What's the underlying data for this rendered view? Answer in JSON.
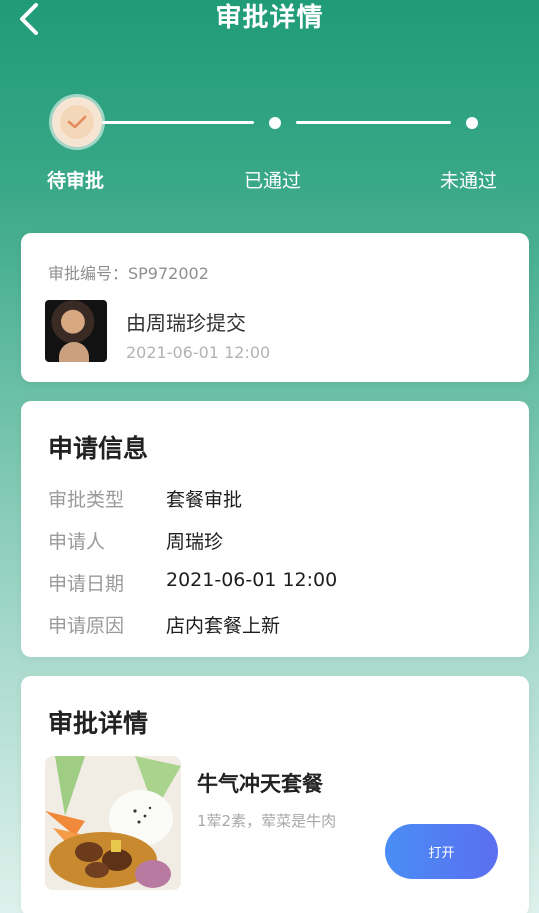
{
  "header": {
    "title": "审批详情"
  },
  "steps": [
    {
      "label": "待审批",
      "state": "active"
    },
    {
      "label": "已通过",
      "state": "pending"
    },
    {
      "label": "未通过",
      "state": "pending"
    }
  ],
  "summary": {
    "approval_no": "审批编号：SP972002",
    "submitter": "由周瑞珍提交",
    "time": "2021-06-01 12:00"
  },
  "application": {
    "title": "申请信息",
    "rows": [
      {
        "key": "审批类型",
        "value": "套餐审批"
      },
      {
        "key": "申请人",
        "value": "周瑞珍"
      },
      {
        "key": "申请日期",
        "value": "2021-06-01 12:00"
      },
      {
        "key": "申请原因",
        "value": "店内套餐上新"
      }
    ]
  },
  "detail": {
    "title": "审批详情",
    "package_name": "牛气冲天套餐",
    "package_desc": "1荤2素，荤菜是牛肉",
    "open_label": "打开"
  },
  "colors": {
    "header_green": "#1f9b78",
    "button_blue": "#4a8df5",
    "step_active_bg": "#f7e5d3",
    "check_color": "#e48a5a"
  }
}
